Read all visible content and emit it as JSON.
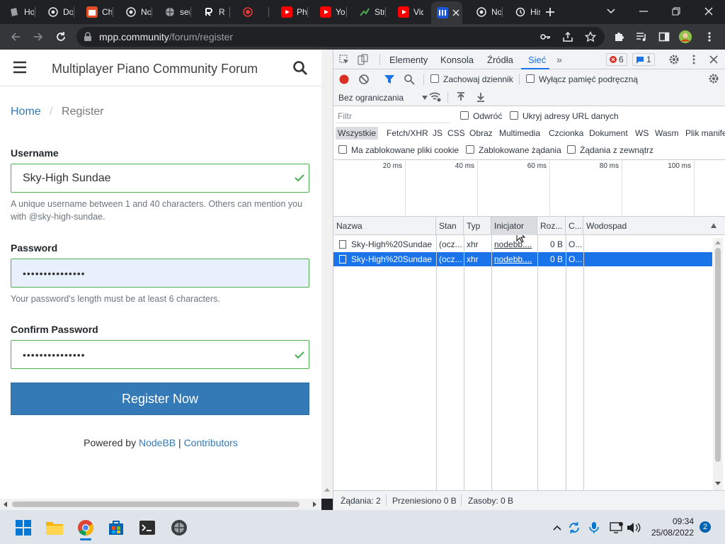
{
  "tabs": [
    {
      "label": "Ho",
      "favicon": "page-icon",
      "color": "#9aa0a6"
    },
    {
      "label": "Do",
      "favicon": "chrome-icon",
      "color": "#e8eaed"
    },
    {
      "label": "Ch",
      "favicon": "store-icon",
      "color": "#e44d26"
    },
    {
      "label": "No",
      "favicon": "chrome-icon",
      "color": "#e8eaed"
    },
    {
      "label": "ser",
      "favicon": "globe-icon",
      "color": "#9aa0a6"
    },
    {
      "label": "R",
      "favicon": "r-icon",
      "color": "#ffffff"
    },
    {
      "label": "",
      "favicon": "record-icon",
      "color": "#e53935"
    },
    {
      "label": "Ph",
      "favicon": "youtube-icon",
      "color": "#ff0000"
    },
    {
      "label": "You",
      "favicon": "youtube-icon",
      "color": "#ff0000"
    },
    {
      "label": "Str",
      "favicon": "stream-icon",
      "color": "#4caf50"
    },
    {
      "label": "Vid",
      "favicon": "youtube-icon",
      "color": "#ff0000"
    },
    {
      "label": "",
      "favicon": "mpp-icon",
      "color": "#1a57d6",
      "active": true
    },
    {
      "label": "No",
      "favicon": "chrome-icon",
      "color": "#e8eaed"
    },
    {
      "label": "His",
      "favicon": "history-icon",
      "color": "#e8eaed"
    }
  ],
  "omnibox": {
    "domain": "mpp.community",
    "path": "/forum/register"
  },
  "page": {
    "site_title": "Multiplayer Piano Community Forum",
    "breadcrumb_home": "Home",
    "breadcrumb_sep": "/",
    "breadcrumb_current": "Register",
    "username_label": "Username",
    "username_value": "Sky-High Sundae",
    "username_help": "A unique username between 1 and 40 characters. Others can mention you with @sky-high-sundae.",
    "password_label": "Password",
    "password_value": "•••••••••••••••",
    "password_help": "Your password's length must be at least 6 characters.",
    "confirm_label": "Confirm Password",
    "confirm_value": "•••••••••••••••",
    "register_button": "Register Now",
    "powered_by": "Powered by",
    "nodebb_link": "NodeBB",
    "pipe": "|",
    "contributors_link": "Contributors",
    "accent_color": "#337ab7"
  },
  "devtools": {
    "tabs": [
      "Elementy",
      "Konsola",
      "Źródła",
      "Sieć"
    ],
    "active_tab": "Sieć",
    "error_count": "6",
    "message_count": "1",
    "preserve_log": "Zachowaj dziennik",
    "disable_cache": "Wyłącz pamięć podręczną",
    "throttling": "Bez ograniczania",
    "filter_placeholder": "Filtr",
    "invert": "Odwróć",
    "hide_data_urls": "Ukryj adresy URL danych",
    "type_filters": [
      "Wszystkie",
      "Fetch/XHR",
      "JS",
      "CSS",
      "Obraz",
      "Multimedia",
      "Czcionka",
      "Dokument",
      "WS",
      "Wasm",
      "Plik manifestu"
    ],
    "blocked_cookies": "Ma zablokowane pliki cookie",
    "blocked_requests": "Zablokowane żądania",
    "third_party": "Żądania z zewnątrz",
    "timeline_ticks": [
      "20 ms",
      "40 ms",
      "60 ms",
      "80 ms",
      "100 ms"
    ],
    "columns": [
      "Nazwa",
      "Stan",
      "Typ",
      "Inicjator",
      "Roz...",
      "C...",
      "Wodospad"
    ],
    "rows": [
      {
        "name": "Sky-High%20Sundae",
        "status": "(ocz...",
        "type": "xhr",
        "initiator": "nodebb....",
        "size": "0 B",
        "time": "O..."
      },
      {
        "name": "Sky-High%20Sundae",
        "status": "(ocz...",
        "type": "xhr",
        "initiator": "nodebb....",
        "size": "0 B",
        "time": "O...",
        "selected": true
      }
    ],
    "status_requests": "Żądania: 2",
    "status_transferred": "Przeniesiono 0 B",
    "status_resources": "Zasoby: 0 B"
  },
  "taskbar": {
    "time": "09:34",
    "date": "25/08/2022",
    "notifications": "2"
  }
}
